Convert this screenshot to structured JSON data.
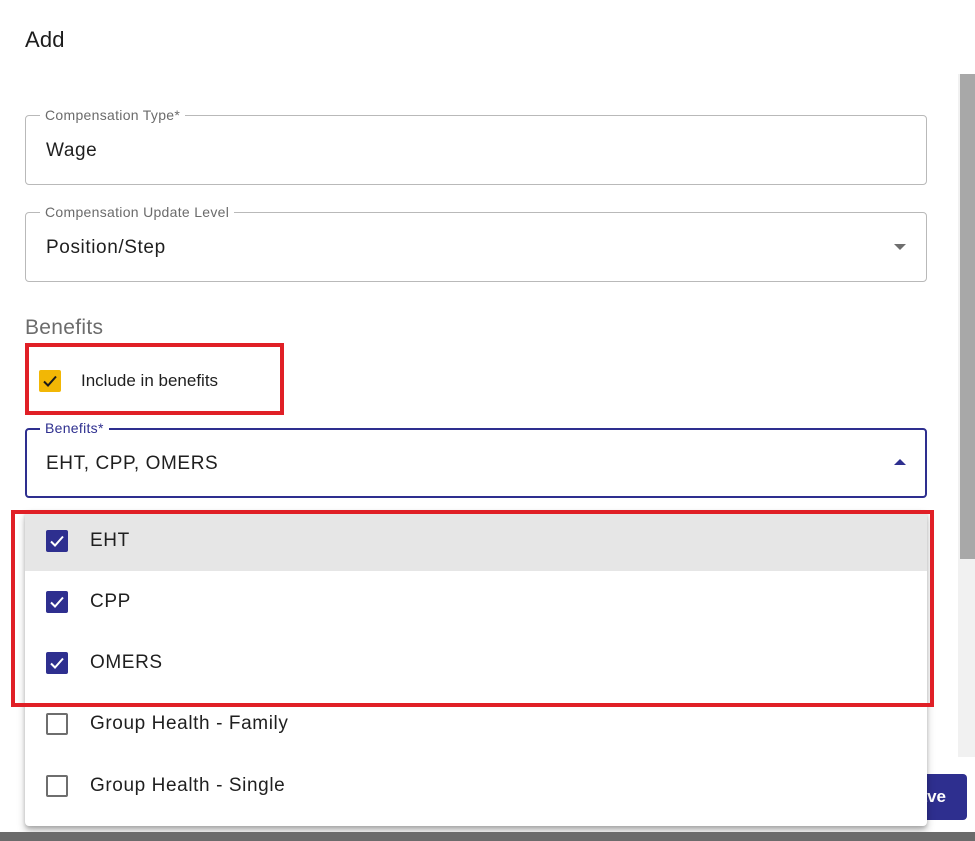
{
  "dialog": {
    "title": "Add"
  },
  "fields": {
    "compensation_type": {
      "label": "Compensation Type*",
      "value": "Wage"
    },
    "update_level": {
      "label": "Compensation Update Level",
      "value": "Position/Step"
    },
    "benefits": {
      "label": "Benefits*",
      "value": "EHT, CPP, OMERS"
    }
  },
  "benefits_section": {
    "heading": "Benefits",
    "include_label": "Include in benefits",
    "include_checked": true
  },
  "menu": {
    "items": [
      {
        "label": "EHT",
        "checked": true
      },
      {
        "label": "CPP",
        "checked": true
      },
      {
        "label": "OMERS",
        "checked": true
      },
      {
        "label": "Group Health - Family",
        "checked": false
      },
      {
        "label": "Group Health - Single",
        "checked": false
      }
    ]
  },
  "footer": {
    "save_label": "Save"
  },
  "colors": {
    "primary": "#2e2f8f",
    "accent": "#f2b705",
    "highlight": "#e01f26"
  }
}
